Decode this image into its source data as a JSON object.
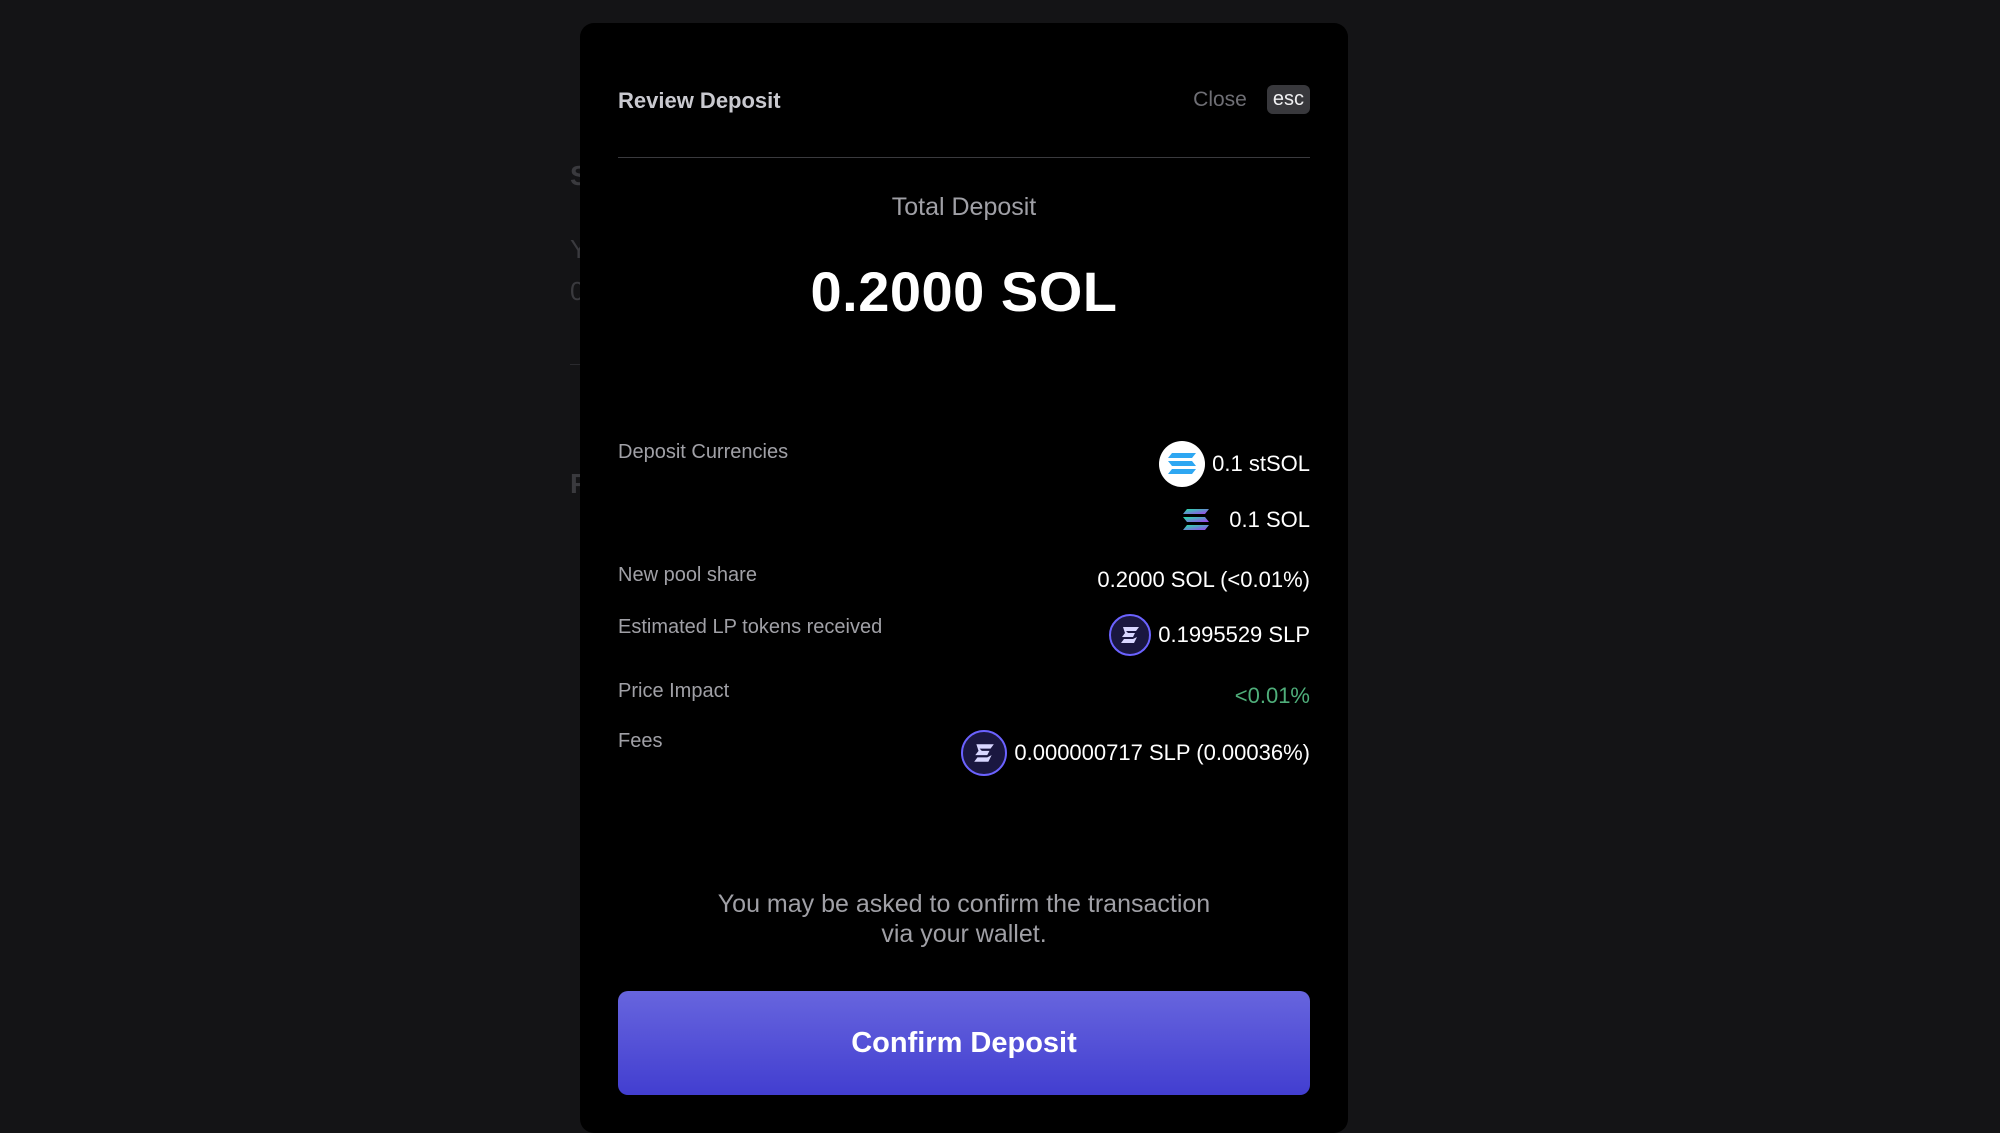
{
  "background": {
    "fragments": [
      "S",
      "Y",
      "0",
      "P"
    ]
  },
  "modal": {
    "title": "Review Deposit",
    "close_label": "Close",
    "esc_label": "esc",
    "total_label": "Total Deposit",
    "total_value": "0.2000 SOL",
    "rows": {
      "deposit_currencies": {
        "label": "Deposit Currencies",
        "values": [
          {
            "icon": "stsol-icon",
            "text": "0.1 stSOL"
          },
          {
            "icon": "sol-icon",
            "text": "0.1 SOL"
          }
        ]
      },
      "new_pool_share": {
        "label": "New pool share",
        "value": "0.2000 SOL (<0.01%)"
      },
      "estimated_lp": {
        "label": "Estimated LP tokens received",
        "icon": "slp-icon",
        "value": "0.1995529 SLP"
      },
      "price_impact": {
        "label": "Price Impact",
        "value": "<0.01%"
      },
      "fees": {
        "label": "Fees",
        "icon": "slp-icon",
        "value": "0.000000717 SLP (0.00036%)"
      }
    },
    "note": {
      "line1": "You may be asked to confirm the transaction",
      "line2": "via your wallet."
    },
    "confirm_label": "Confirm Deposit"
  },
  "colors": {
    "background": "#141416",
    "modal": "#000000",
    "accent": "#5a57d8",
    "positive": "#4fae7a",
    "slp_ring": "#6b62ff"
  }
}
